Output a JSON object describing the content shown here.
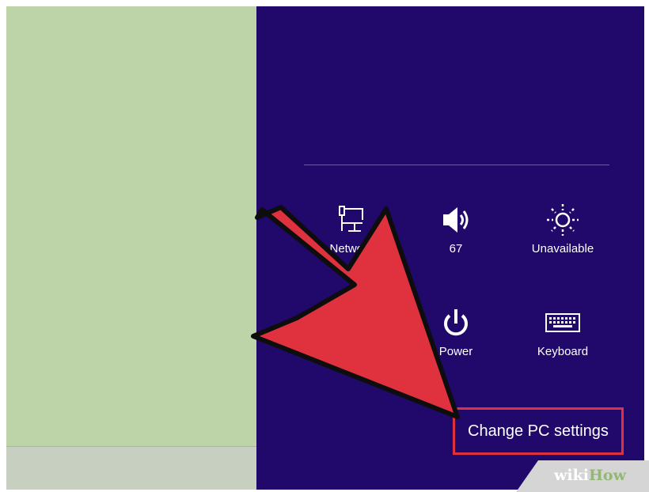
{
  "charms_panel": {
    "tiles": [
      {
        "label": "Network",
        "icon": "network-icon"
      },
      {
        "label": "67",
        "icon": "volume-icon"
      },
      {
        "label": "Unavailable",
        "icon": "brightness-icon"
      },
      {
        "label": "",
        "icon": "notifications-icon"
      },
      {
        "label": "Power",
        "icon": "power-icon"
      },
      {
        "label": "Keyboard",
        "icon": "keyboard-icon"
      }
    ],
    "change_pc_settings": "Change PC settings"
  },
  "watermark": {
    "wiki": "wiki",
    "how": "How"
  },
  "colors": {
    "charms_bg": "#21096b",
    "desktop_bg": "#bcd4a8",
    "arrow": "#e0313f",
    "highlight_box": "#e0313f"
  }
}
